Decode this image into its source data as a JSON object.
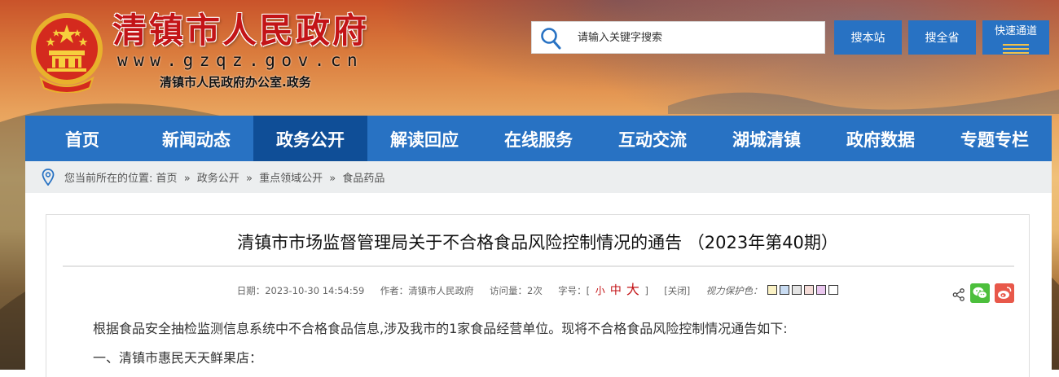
{
  "header": {
    "site_name": "清镇市人民政府",
    "site_url": "www.gzqz.gov.cn",
    "site_subtitle": "清镇市人民政府办公室.政务",
    "search_placeholder": "请输入关键字搜索",
    "search_site_label": "搜本站",
    "search_province_label": "搜全省",
    "quick_access_label": "快速通道"
  },
  "nav": {
    "items": [
      "首页",
      "新闻动态",
      "政务公开",
      "解读回应",
      "在线服务",
      "互动交流",
      "湖城清镇",
      "政府数据",
      "专题专栏"
    ],
    "active_index": 2
  },
  "breadcrumb": {
    "prefix": "您当前所在的位置:",
    "items": [
      "首页",
      "政务公开",
      "重点领域公开",
      "食品药品"
    ],
    "separator": "»"
  },
  "article": {
    "title": "清镇市市场监督管理局关于不合格食品风险控制情况的通告 （2023年第40期）",
    "meta": {
      "date_label": "日期：",
      "date": "2023-10-30 14:54:59",
      "author_label": "作者：",
      "author": "清镇市人民政府",
      "views_label": "访问量：",
      "views": "2次",
      "font_size_label": "字号：[",
      "font_small": "小",
      "font_medium": "中",
      "font_large": "大",
      "font_size_end": "]",
      "close_label": "[关闭]",
      "vision_label": "视力保护色：",
      "vision_colors": [
        "#fbf2c5",
        "#c9dcf2",
        "#e4e4e4",
        "#f5dcd8",
        "#eac7ef",
        "#ffffff"
      ]
    },
    "paragraphs": [
      "根据食品安全抽检监测信息系统中不合格食品信息,涉及我市的1家食品经营单位。现将不合格食品风险控制情况通告如下:",
      "一、清镇市惠民天天鲜果店："
    ]
  },
  "colors": {
    "brand_red": "#c31417",
    "nav_blue": "#2872c3",
    "nav_active": "#0f4e97"
  }
}
